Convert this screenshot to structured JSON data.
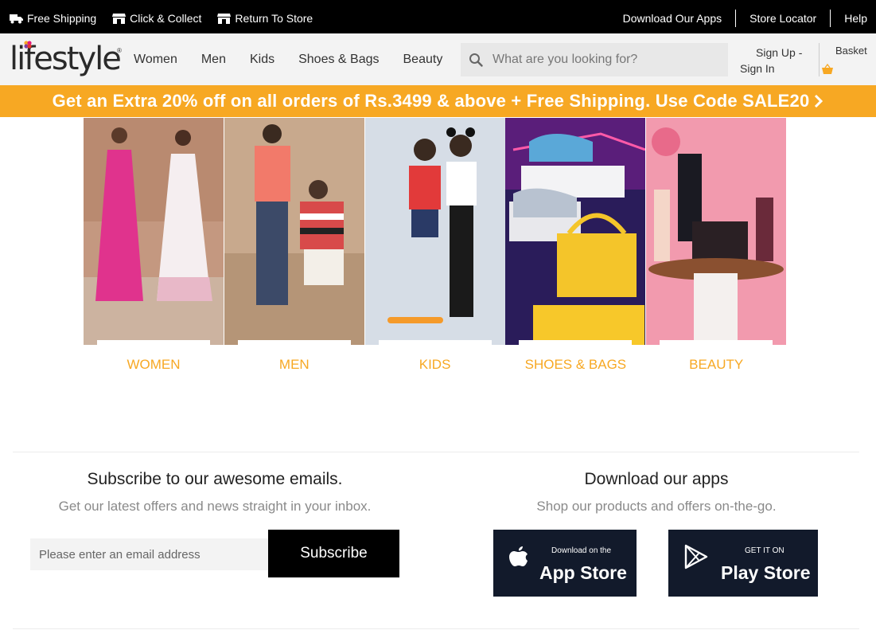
{
  "topbar": {
    "left": [
      {
        "icon": "truck-icon",
        "label": "Free Shipping"
      },
      {
        "icon": "store-icon",
        "label": "Click & Collect"
      },
      {
        "icon": "return-store-icon",
        "label": "Return To Store"
      }
    ],
    "right": [
      "Download Our Apps",
      "Store Locator",
      "Help"
    ]
  },
  "header": {
    "logo_text": "lifestyle",
    "logo_reg": "®",
    "nav": [
      "Women",
      "Men",
      "Kids",
      "Shoes & Bags",
      "Beauty"
    ],
    "search_placeholder": "What are you looking for?",
    "signup": "Sign Up -",
    "signin": "Sign In",
    "basket": "Basket"
  },
  "promo": {
    "text": "Get an Extra 20% off on all orders of Rs.3499 & above + Free Shipping. Use Code SALE20"
  },
  "categories": [
    {
      "label": "WOMEN"
    },
    {
      "label": "MEN"
    },
    {
      "label": "KIDS"
    },
    {
      "label": "SHOES & BAGS"
    },
    {
      "label": "BEAUTY"
    }
  ],
  "subscribe": {
    "title": "Subscribe to our awesome emails.",
    "desc": "Get our latest offers and news straight in your inbox.",
    "placeholder": "Please enter an email address",
    "button": "Subscribe"
  },
  "apps": {
    "title": "Download our apps",
    "desc": "Shop our products and offers on-the-go.",
    "apple_small": "Download on the",
    "apple_big": "App Store",
    "google_small": "GET IT ON",
    "google_big": "Play Store"
  },
  "colors": {
    "accent": "#f7a823",
    "topbar": "#000000",
    "header_bg": "#f3f3f3",
    "store_badge": "#121a2b"
  }
}
